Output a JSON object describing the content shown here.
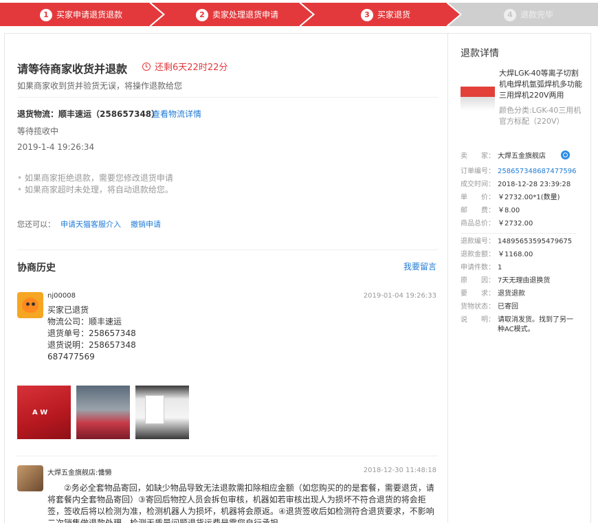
{
  "steps": [
    {
      "num": "1",
      "label": "买家申请退货退款"
    },
    {
      "num": "2",
      "label": "卖家处理退货申请"
    },
    {
      "num": "3",
      "label": "买家退货"
    },
    {
      "num": "4",
      "label": "退款完毕"
    }
  ],
  "colors": {
    "accent": "#e4393c",
    "inactive": "#cfcfcf",
    "link": "#1f7bd6"
  },
  "status": {
    "title": "请等待商家收货并退款",
    "countdown": "还剩6天22时22分",
    "subtitle": "如果商家收到货并验货无误，将操作退款给您"
  },
  "logistics": {
    "label": "退货物流：顺丰速运（258657348）",
    "link": "查看物流详情",
    "state": "等待揽收中",
    "time": "2019-1-4 19:26:34"
  },
  "tips": [
    "如果商家拒绝退款，需要您修改退货申请",
    "如果商家超时未处理，将自动退款给您。"
  ],
  "actions": {
    "prefix": "您还可以：",
    "appeal": "申请天猫客服介入",
    "cancel": "撤销申请"
  },
  "history": {
    "title": "协商历史",
    "leave_message": "我要留言",
    "entries": [
      {
        "user": "nj00008",
        "time": "2019-01-04 19:26:33",
        "lines": [
          "买家已退货",
          "物流公司：顺丰速运",
          "退货单号：258657348",
          "退货说明：258657348",
          "687477569"
        ]
      },
      {
        "user": "大焊五金旗舰店:慵懒",
        "time": "2018-12-30 11:48:18",
        "text": "　　②务必全套物品寄回，如缺少物品导致无法退款需扣除相应金额（如您购买的的是套餐，需要退货，请将套餐内全套物品寄回）③寄回后物控人员会拆包审核，机器如若审核出现人为损坏不符合退货的将会拒签，签收后将以检测为准，检测机器人为损坏，机器将会原返。④退货签收后如检测符合退货要求，不影响二次销售做退款处理，检测无质量问题退货运费是需您自行承担。"
      }
    ]
  },
  "side": {
    "title": "退款详情",
    "product_name": "大焊LGK-40等离子切割机电焊机氩弧焊机多功能三用焊机220V两用",
    "product_attr": "颜色分类:LGK-40三用机 官方标配（220V）",
    "rows1": [
      {
        "k": "卖　　家：",
        "v": "大焊五金旗舰店"
      },
      {
        "k": "订单编号：",
        "v": "258657348687477596",
        "link": true
      },
      {
        "k": "成交时间：",
        "v": "2018-12-28 23:39:28"
      },
      {
        "k": "单　　价：",
        "v": "￥2732.00*1(数量)"
      },
      {
        "k": "邮　　费：",
        "v": "￥8.00"
      },
      {
        "k": "商品总价：",
        "v": "￥2732.00"
      }
    ],
    "rows2": [
      {
        "k": "退款编号：",
        "v": "14895653595479675"
      },
      {
        "k": "退款金额：",
        "v": "￥1168.00"
      },
      {
        "k": "申请件数：",
        "v": "1"
      },
      {
        "k": "原　　因：",
        "v": "7天无理由退换货"
      },
      {
        "k": "要　　求：",
        "v": "退货退款"
      },
      {
        "k": "货物状态：",
        "v": "已寄回"
      },
      {
        "k": "说　　明：",
        "v": "请取消发货。找到了另一种AC模式。"
      }
    ]
  }
}
